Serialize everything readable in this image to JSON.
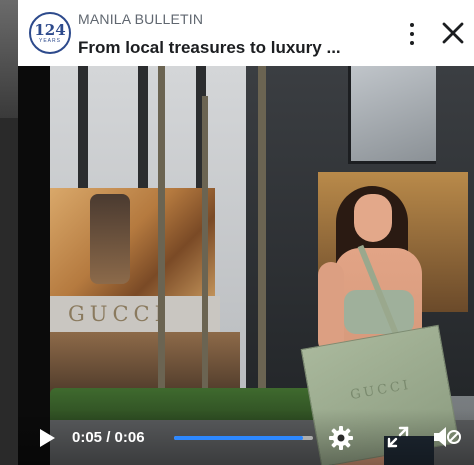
{
  "header": {
    "logo_number": "124",
    "logo_subtext": "YEARS",
    "source_name": "MANILA BULLETIN",
    "title": "From local treasures to luxury ..."
  },
  "video": {
    "storefront_sign": "GUCCI",
    "bag_text": "GUCCI"
  },
  "controls": {
    "current_time": "0:05",
    "duration": "0:06",
    "time_display": "0:05 / 0:06",
    "progress": 0.93
  },
  "icons": {
    "more": "more-vertical-icon",
    "close": "close-icon",
    "play": "play-icon",
    "settings": "gear-icon",
    "fullscreen": "expand-icon",
    "mute": "volume-muted-icon"
  },
  "colors": {
    "brand": "#2d4a8c",
    "progress": "#2d88ff"
  }
}
